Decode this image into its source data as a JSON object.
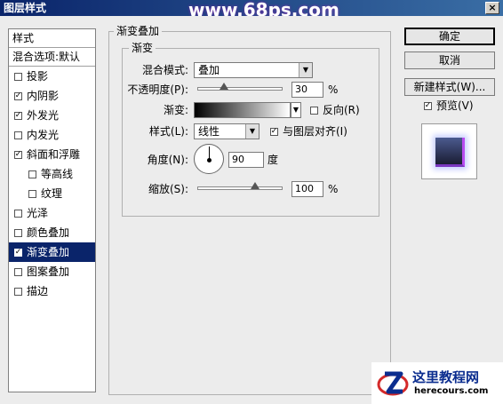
{
  "window": {
    "title": "图层样式",
    "close_glyph": "×",
    "watermark": "www.68ps.com"
  },
  "styles_list": {
    "header": "样式",
    "blend_options": "混合选项:默认",
    "items": [
      {
        "label": "投影",
        "checked": false,
        "sub": false
      },
      {
        "label": "内阴影",
        "checked": true,
        "sub": false
      },
      {
        "label": "外发光",
        "checked": true,
        "sub": false
      },
      {
        "label": "内发光",
        "checked": false,
        "sub": false
      },
      {
        "label": "斜面和浮雕",
        "checked": true,
        "sub": false
      },
      {
        "label": "等高线",
        "checked": false,
        "sub": true
      },
      {
        "label": "纹理",
        "checked": false,
        "sub": true
      },
      {
        "label": "光泽",
        "checked": false,
        "sub": false
      },
      {
        "label": "颜色叠加",
        "checked": false,
        "sub": false
      },
      {
        "label": "渐变叠加",
        "checked": true,
        "sub": false,
        "selected": true
      },
      {
        "label": "图案叠加",
        "checked": false,
        "sub": false
      },
      {
        "label": "描边",
        "checked": false,
        "sub": false
      }
    ]
  },
  "panel": {
    "outer_title": "渐变叠加",
    "inner_title": "渐变",
    "blend_mode_label": "混合模式:",
    "blend_mode_value": "叠加",
    "opacity_label": "不透明度(P):",
    "opacity_value": "30",
    "opacity_unit": "%",
    "opacity_level": 30,
    "gradient_label": "渐变:",
    "reverse_label": "反向(R)",
    "reverse_checked": false,
    "style_label": "样式(L):",
    "style_value": "线性",
    "align_label": "与图层对齐(I)",
    "align_checked": true,
    "angle_label": "角度(N):",
    "angle_value": "90",
    "angle_unit": "度",
    "scale_label": "缩放(S):",
    "scale_value": "100",
    "scale_unit": "%",
    "scale_level": 100
  },
  "buttons": {
    "ok": "确定",
    "cancel": "取消",
    "new_style": "新建样式(W)...",
    "preview_label": "预览(V)",
    "preview_checked": true
  },
  "brand": {
    "cn": "这里教程网",
    "en": "herecours.com"
  },
  "colors": {
    "selection": "#0a246a",
    "brand_blue": "#0b2d8f",
    "glow": "#b84cf0"
  }
}
